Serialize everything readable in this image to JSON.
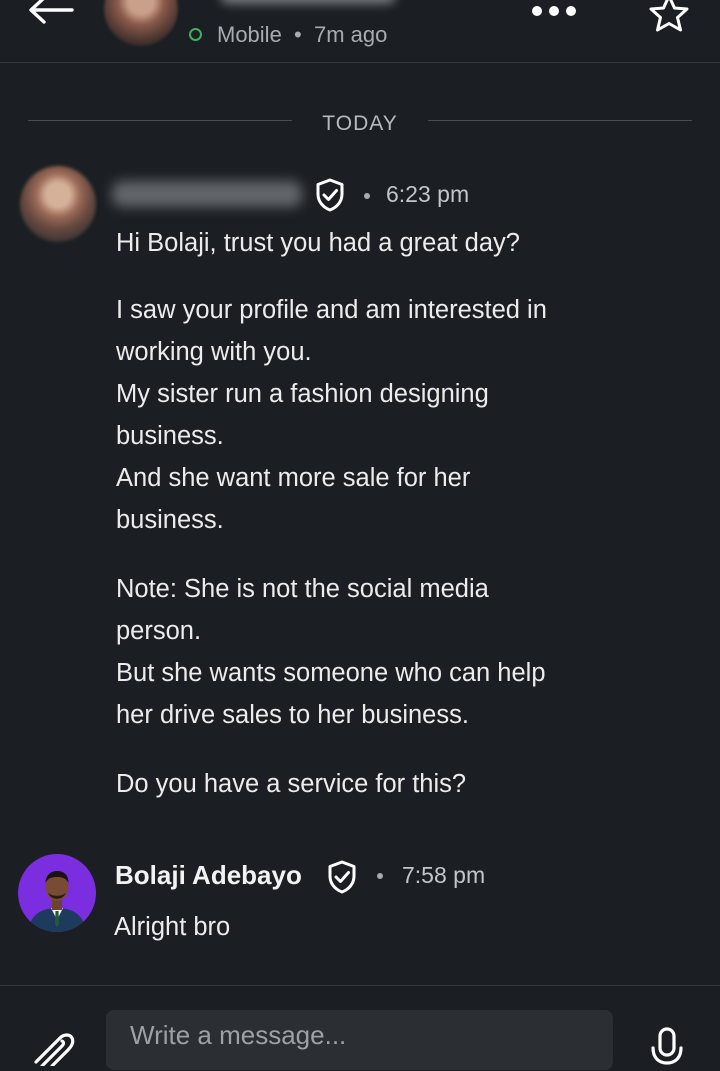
{
  "header": {
    "status": "Mobile",
    "last_active": "7m ago"
  },
  "divider": {
    "label": "TODAY"
  },
  "messages": [
    {
      "time": "6:23 pm",
      "paragraphs": [
        "Hi Bolaji, trust you had a great day?",
        "I saw your profile and am interested in",
        "working with you.",
        "My sister run a fashion designing",
        "business.",
        "And she want more sale for her",
        "business.",
        "Note: She is not the social media",
        "person.",
        "But she wants someone who can help",
        "her drive sales to her business.",
        "Do you have a service for this?"
      ]
    },
    {
      "sender": "Bolaji Adebayo",
      "time": "7:58 pm",
      "text": "Alright bro"
    }
  ],
  "composer": {
    "placeholder": "Write a message..."
  },
  "colors": {
    "background": "#1b1f23",
    "online": "#41b05a",
    "avatar_bg": "#7b2ee0"
  },
  "icons": [
    "back-arrow-icon",
    "more-icon",
    "star-icon",
    "verified-shield-icon",
    "paperclip-icon",
    "microphone-icon"
  ]
}
